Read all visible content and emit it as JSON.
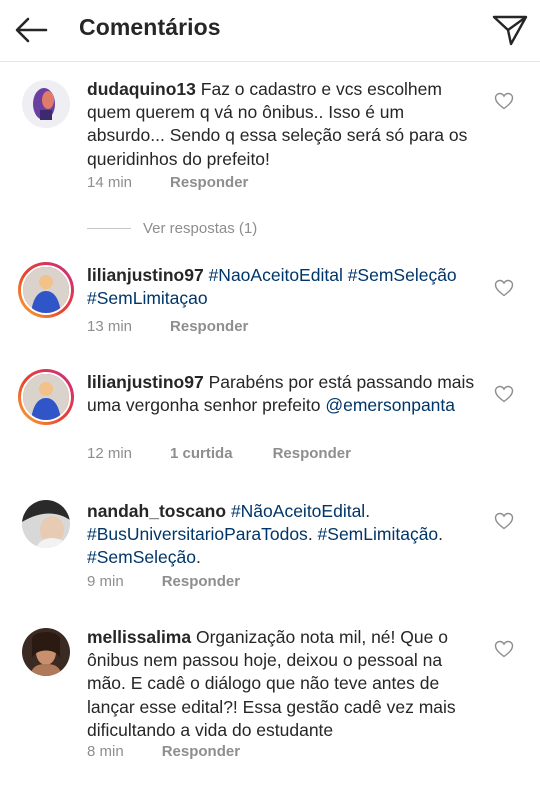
{
  "header": {
    "title": "Comentários"
  },
  "comments": [
    {
      "username": "dudaquino13",
      "text": "Faz o cadastro e vcs escolhem quem querem q vá no ônibus.. Isso é um absurdo... Sendo q essa seleção será só para os queridinhos do prefeito!",
      "time": "14 min",
      "reply": "Responder",
      "view_replies": "Ver respostas (1)"
    },
    {
      "username": "lilianjustino97",
      "hashtags": [
        "#NaoAceitoEdital",
        "#SemSeleção",
        "#SemLimitaçao"
      ],
      "time": "13 min",
      "reply": "Responder"
    },
    {
      "username": "lilianjustino97",
      "text": "Parabéns por está passando mais uma vergonha senhor prefeito",
      "mention": "@emersonpanta",
      "time": "12 min",
      "likes": "1 curtida",
      "reply": "Responder"
    },
    {
      "username": "nandah_toscano",
      "hashtags": [
        "#NãoAceitoEdital",
        "#BusUniversitarioParaTodos",
        "#SemLimitação",
        "#SemSeleção"
      ],
      "time": "9 min",
      "reply": "Responder"
    },
    {
      "username": "mellissalima",
      "text": "Organização nota mil, né! Que o ônibus nem passou hoje, deixou o pessoal na mão. E cadê o diálogo que não teve antes de lançar esse edital?! Essa gestão cadê vez mais dificultando a vida do estudante",
      "time": "8 min",
      "reply": "Responder"
    }
  ],
  "icons": {
    "back": "arrow-left-icon",
    "send": "paper-plane-icon",
    "like": "heart-outline-icon"
  },
  "colors": {
    "hashtag": "#003569",
    "meta": "#8e8e8e",
    "text": "#262626"
  }
}
